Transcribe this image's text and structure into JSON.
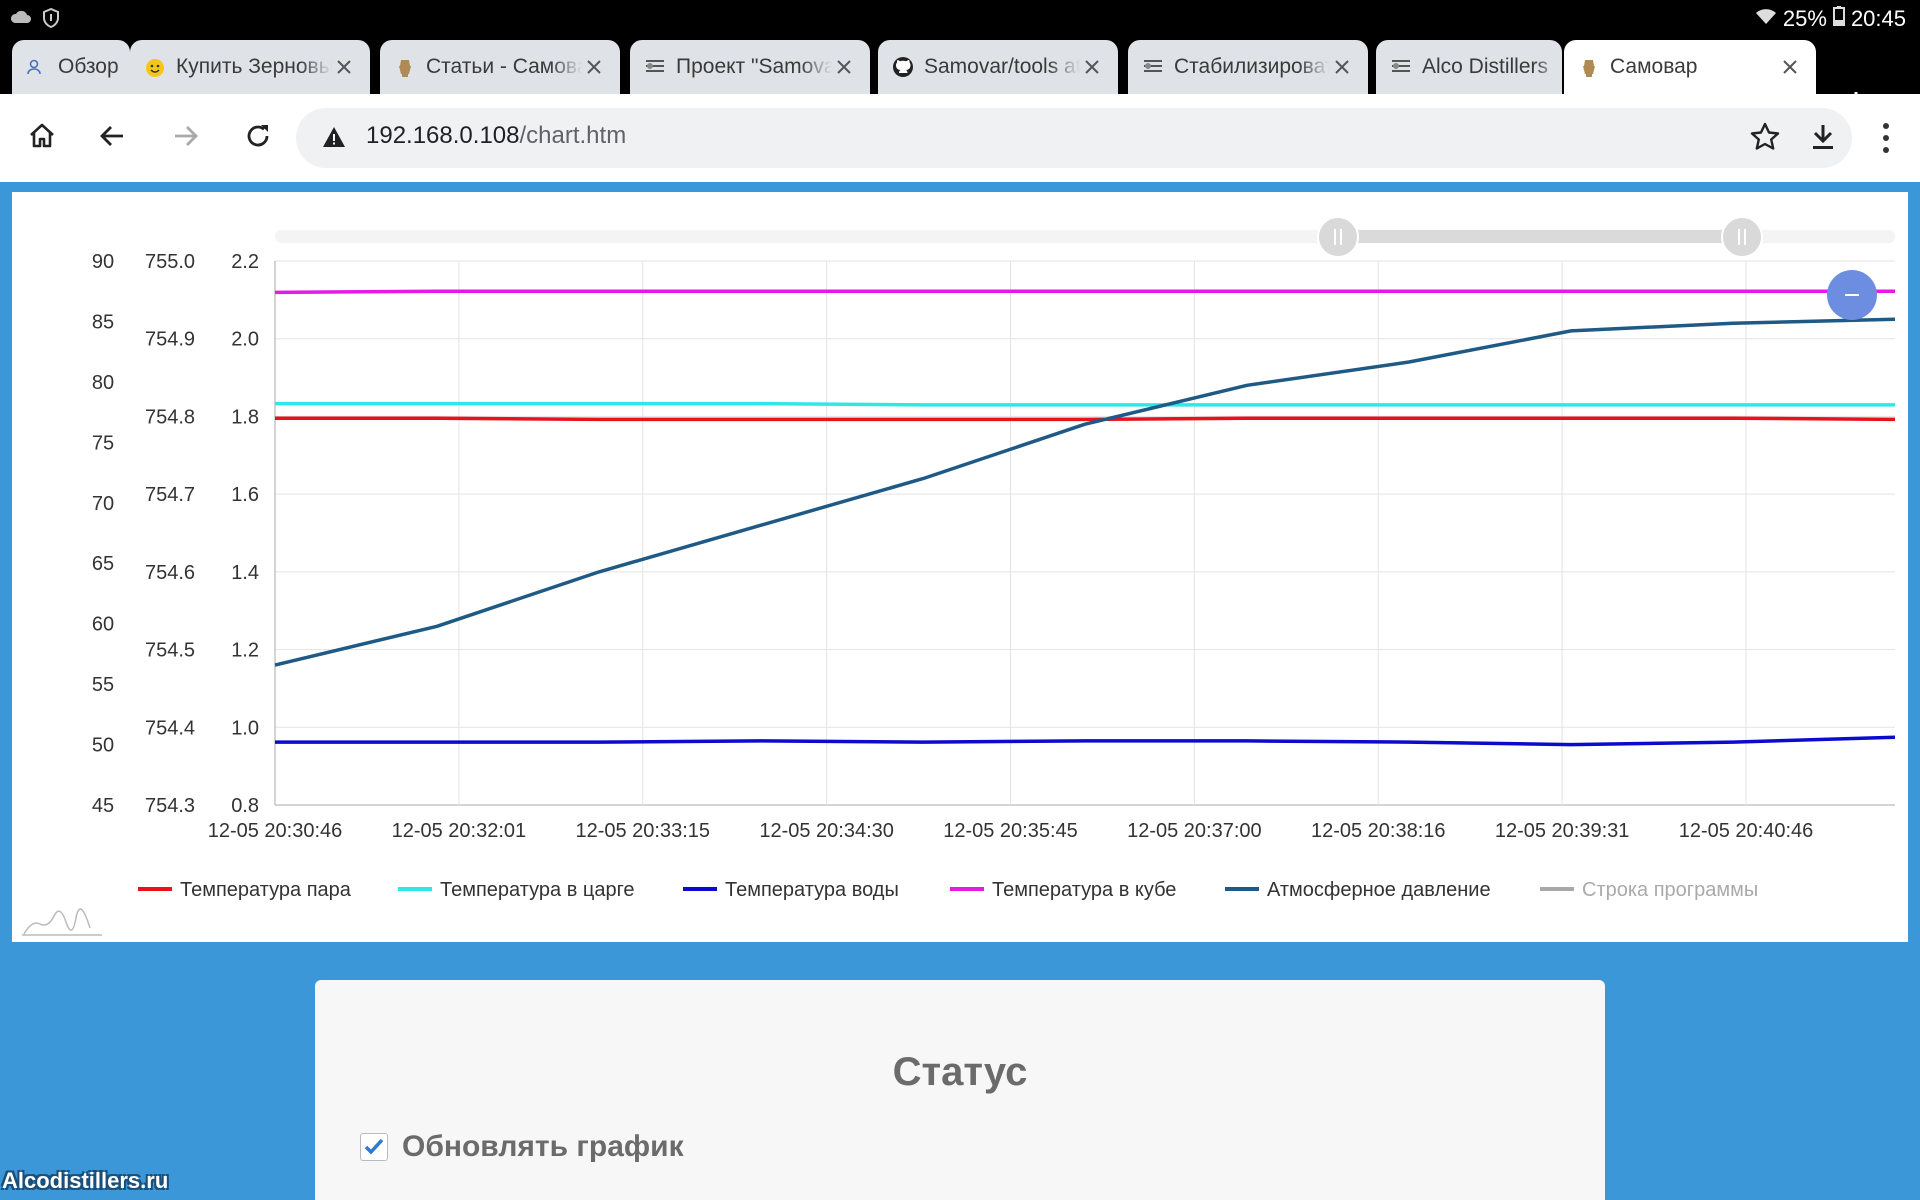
{
  "status_bar": {
    "battery": "25%",
    "time": "20:45",
    "icons": [
      "cloud-icon",
      "shield-icon",
      "wifi-icon",
      "battery-icon"
    ]
  },
  "tabs": [
    {
      "title": "Обзор",
      "icon": "users-icon",
      "active": false
    },
    {
      "title": "Купить Зерновые",
      "icon": "emoji-icon",
      "active": false
    },
    {
      "title": "Статьи - Самовар",
      "icon": "samovar-icon",
      "active": false
    },
    {
      "title": "Проект \"Samovar\"",
      "icon": "forum-icon",
      "active": false
    },
    {
      "title": "Samovar/tools at",
      "icon": "github-icon",
      "active": false
    },
    {
      "title": "Стабилизировать",
      "icon": "forum-icon",
      "active": false
    },
    {
      "title": "Alco Distillers",
      "icon": "forum-icon",
      "active": false
    },
    {
      "title": "Самовар",
      "icon": "samovar-icon",
      "active": true
    }
  ],
  "address_bar": {
    "host": "192.168.0.108",
    "path": "/chart.htm"
  },
  "chart_data": {
    "type": "line",
    "x_ticks": [
      "12-05 20:30:46",
      "12-05 20:32:01",
      "12-05 20:33:15",
      "12-05 20:34:30",
      "12-05 20:35:45",
      "12-05 20:37:00",
      "12-05 20:38:16",
      "12-05 20:39:31",
      "12-05 20:40:46"
    ],
    "y_axes": [
      {
        "ticks": [
          "90",
          "85",
          "80",
          "75",
          "70",
          "65",
          "60",
          "55",
          "50",
          "45"
        ],
        "range": [
          45,
          90
        ]
      },
      {
        "ticks": [
          "755.0",
          "754.9",
          "754.8",
          "754.7",
          "754.6",
          "754.5",
          "754.4",
          "754.3"
        ],
        "range": [
          754.3,
          755.0
        ]
      },
      {
        "ticks": [
          "2.2",
          "2.0",
          "1.8",
          "1.6",
          "1.4",
          "1.2",
          "1.0",
          "0.8"
        ],
        "range": [
          0.8,
          2.2
        ]
      }
    ],
    "grid": true,
    "legend_position": "bottom",
    "series": [
      {
        "name": "Температура пара",
        "color": "#e8111c",
        "axis": 0,
        "values": [
          77.0,
          77.0,
          76.9,
          76.9,
          76.9,
          76.9,
          77.0,
          77.0,
          77.0,
          77.0,
          76.9
        ]
      },
      {
        "name": "Температура в царге",
        "color": "#2ee8e8",
        "axis": 0,
        "values": [
          78.2,
          78.2,
          78.2,
          78.2,
          78.1,
          78.1,
          78.1,
          78.1,
          78.1,
          78.1,
          78.1
        ]
      },
      {
        "name": "Температура воды",
        "color": "#0b0bce",
        "axis": 0,
        "values": [
          50.2,
          50.2,
          50.2,
          50.3,
          50.2,
          50.3,
          50.3,
          50.2,
          50.0,
          50.2,
          50.6
        ]
      },
      {
        "name": "Температура в кубе",
        "color": "#e619e6",
        "axis": 0,
        "values": [
          87.4,
          87.5,
          87.5,
          87.5,
          87.5,
          87.5,
          87.5,
          87.5,
          87.5,
          87.5,
          87.5
        ]
      },
      {
        "name": "Атмосферное давление",
        "color": "#1e5a85",
        "axis": 1,
        "values": [
          754.48,
          754.53,
          754.6,
          754.66,
          754.72,
          754.79,
          754.84,
          754.87,
          754.91,
          754.92,
          754.925
        ]
      },
      {
        "name": "Строка программы",
        "color": "#a8a8a8",
        "axis": 2,
        "values": []
      }
    ]
  },
  "status_card": {
    "title": "Статус",
    "checkbox_label": "Обновлять график",
    "checked": true
  },
  "watermark": "Alcodistillers.ru"
}
